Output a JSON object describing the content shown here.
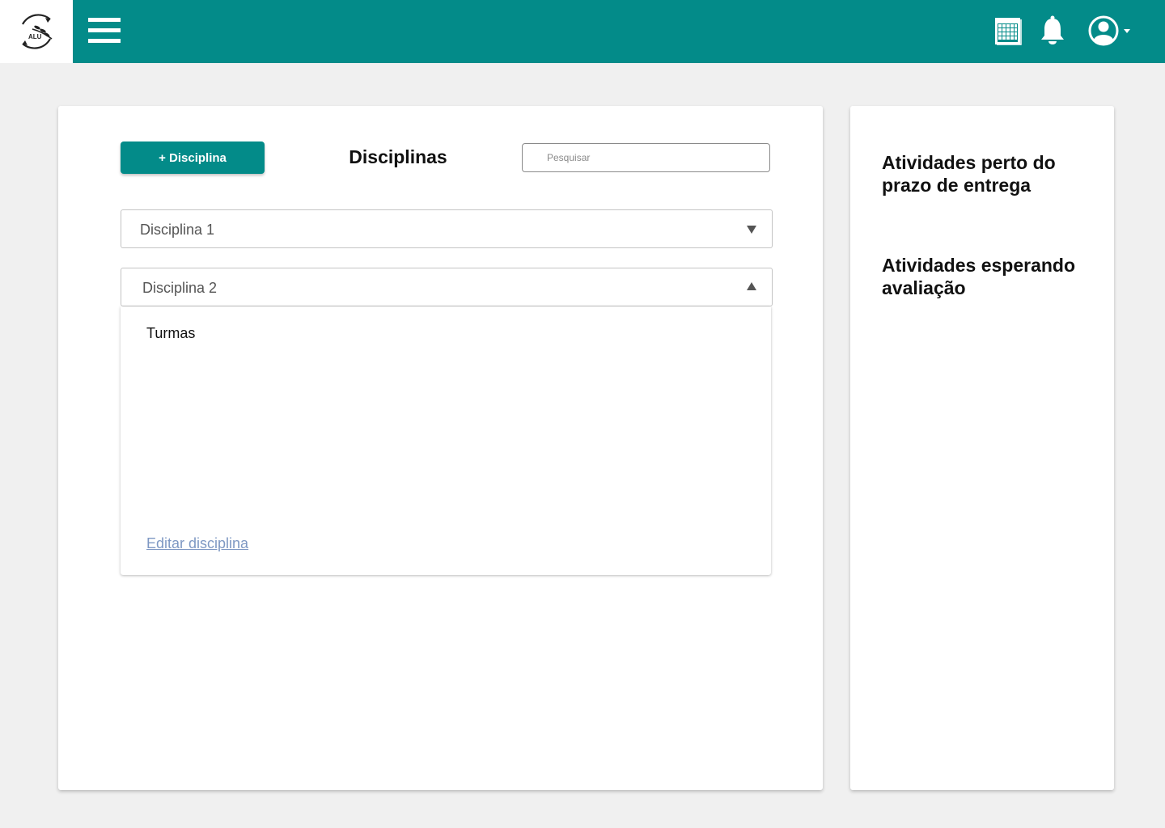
{
  "app": {
    "logo_text": "ALU",
    "colors": {
      "primary": "#038b89",
      "link": "#7e98c3",
      "background": "#f0f0f0"
    }
  },
  "header": {
    "icons": [
      "menu-icon",
      "calendar-icon",
      "bell-icon",
      "user-avatar-icon",
      "caret-down-icon"
    ]
  },
  "main": {
    "add_button_label": "+ Disciplina",
    "title": "Disciplinas",
    "search": {
      "placeholder": "Pesquisar",
      "value": ""
    },
    "accordions": [
      {
        "label": "Disciplina 1",
        "expanded": false
      },
      {
        "label": "Disciplina 2",
        "expanded": true,
        "panel": {
          "heading": "Turmas",
          "edit_link": "Editar disciplina"
        }
      }
    ]
  },
  "side": {
    "sections": [
      {
        "title": "Atividades perto do prazo de entrega"
      },
      {
        "title": "Atividades esperando avaliação"
      }
    ]
  }
}
